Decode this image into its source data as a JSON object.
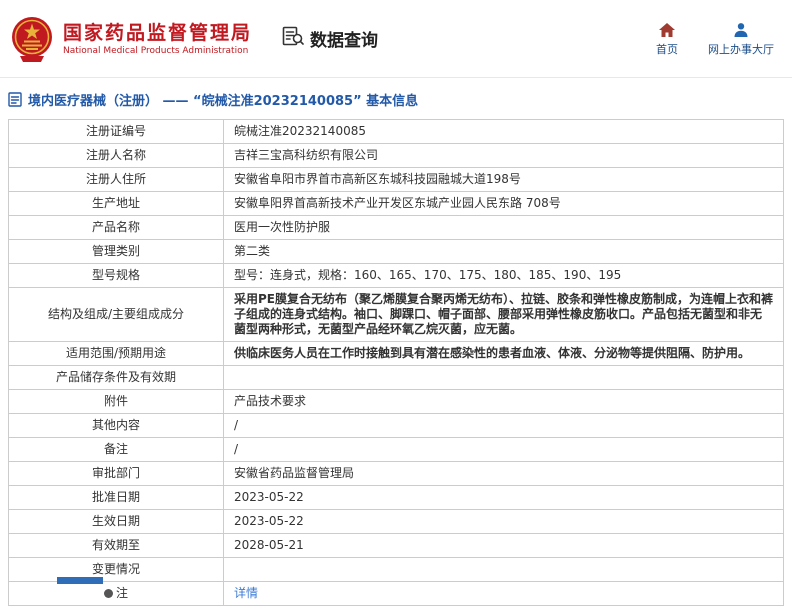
{
  "colors": {
    "brand_red": "#c01920",
    "gold": "#e8b33a",
    "brand_blue": "#2259a8",
    "link_blue": "#3a7bd5",
    "table_border": "#cccccc",
    "footer_blue": "#2f6db8"
  },
  "header": {
    "org_name_cn": "国家药品监督管理局",
    "org_name_en": "National Medical Products Administration",
    "section_title": "数据查询",
    "nav_home": "首页",
    "nav_hall": "网上办事大厅"
  },
  "breadcrumb": {
    "text": "境内医疗器械（注册） ——  “皖械注准20232140085”  基本信息"
  },
  "table": {
    "rows": [
      {
        "label": "注册证编号",
        "value": "皖械注准20232140085"
      },
      {
        "label": "注册人名称",
        "value": "吉祥三宝高科纺织有限公司"
      },
      {
        "label": "注册人住所",
        "value": "安徽省阜阳市界首市高新区东城科技园融城大道198号"
      },
      {
        "label": "生产地址",
        "value": "安徽阜阳界首高新技术产业开发区东城产业园人民东路 708号"
      },
      {
        "label": "产品名称",
        "value": "医用一次性防护服"
      },
      {
        "label": "管理类别",
        "value": "第二类"
      },
      {
        "label": "型号规格",
        "value": "型号：连身式，规格：160、165、170、175、180、185、190、195"
      },
      {
        "label": "结构及组成/主要组成成分",
        "value": "采用PE膜复合无纺布（聚乙烯膜复合聚丙烯无纺布）、拉链、胶条和弹性橡皮筋制成，为连帽上衣和裤子组成的连身式结构。袖口、脚踝口、帽子面部、腰部采用弹性橡皮筋收口。产品包括无菌型和非无菌型两种形式，无菌型产品经环氧乙烷灭菌，应无菌。",
        "compact": true
      },
      {
        "label": "适用范围/预期用途",
        "value": "供临床医务人员在工作时接触到具有潜在感染性的患者血液、体液、分泌物等提供阻隔、防护用。",
        "compact": true
      },
      {
        "label": "产品储存条件及有效期",
        "value": ""
      },
      {
        "label": "附件",
        "value": "产品技术要求"
      },
      {
        "label": "其他内容",
        "value": "/"
      },
      {
        "label": "备注",
        "value": "/"
      },
      {
        "label": "审批部门",
        "value": "安徽省药品监督管理局"
      },
      {
        "label": "批准日期",
        "value": "2023-05-22"
      },
      {
        "label": "生效日期",
        "value": "2023-05-22"
      },
      {
        "label": "有效期至",
        "value": "2028-05-21"
      },
      {
        "label": "变更情况",
        "value": ""
      },
      {
        "label": "注",
        "value": "详情",
        "link": true,
        "label_icon": "note-icon"
      }
    ]
  }
}
